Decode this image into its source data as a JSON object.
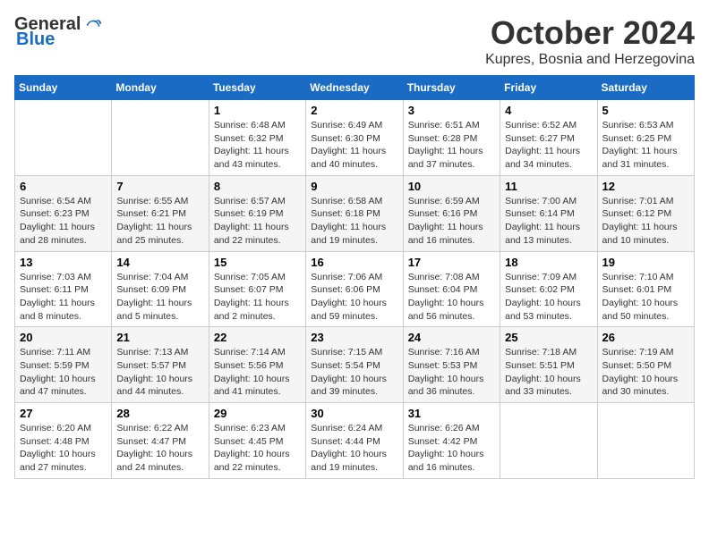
{
  "logo": {
    "general": "General",
    "blue": "Blue"
  },
  "title": "October 2024",
  "location": "Kupres, Bosnia and Herzegovina",
  "days_of_week": [
    "Sunday",
    "Monday",
    "Tuesday",
    "Wednesday",
    "Thursday",
    "Friday",
    "Saturday"
  ],
  "weeks": [
    [
      {
        "day": "",
        "info": ""
      },
      {
        "day": "",
        "info": ""
      },
      {
        "day": "1",
        "info": "Sunrise: 6:48 AM\nSunset: 6:32 PM\nDaylight: 11 hours and 43 minutes."
      },
      {
        "day": "2",
        "info": "Sunrise: 6:49 AM\nSunset: 6:30 PM\nDaylight: 11 hours and 40 minutes."
      },
      {
        "day": "3",
        "info": "Sunrise: 6:51 AM\nSunset: 6:28 PM\nDaylight: 11 hours and 37 minutes."
      },
      {
        "day": "4",
        "info": "Sunrise: 6:52 AM\nSunset: 6:27 PM\nDaylight: 11 hours and 34 minutes."
      },
      {
        "day": "5",
        "info": "Sunrise: 6:53 AM\nSunset: 6:25 PM\nDaylight: 11 hours and 31 minutes."
      }
    ],
    [
      {
        "day": "6",
        "info": "Sunrise: 6:54 AM\nSunset: 6:23 PM\nDaylight: 11 hours and 28 minutes."
      },
      {
        "day": "7",
        "info": "Sunrise: 6:55 AM\nSunset: 6:21 PM\nDaylight: 11 hours and 25 minutes."
      },
      {
        "day": "8",
        "info": "Sunrise: 6:57 AM\nSunset: 6:19 PM\nDaylight: 11 hours and 22 minutes."
      },
      {
        "day": "9",
        "info": "Sunrise: 6:58 AM\nSunset: 6:18 PM\nDaylight: 11 hours and 19 minutes."
      },
      {
        "day": "10",
        "info": "Sunrise: 6:59 AM\nSunset: 6:16 PM\nDaylight: 11 hours and 16 minutes."
      },
      {
        "day": "11",
        "info": "Sunrise: 7:00 AM\nSunset: 6:14 PM\nDaylight: 11 hours and 13 minutes."
      },
      {
        "day": "12",
        "info": "Sunrise: 7:01 AM\nSunset: 6:12 PM\nDaylight: 11 hours and 10 minutes."
      }
    ],
    [
      {
        "day": "13",
        "info": "Sunrise: 7:03 AM\nSunset: 6:11 PM\nDaylight: 11 hours and 8 minutes."
      },
      {
        "day": "14",
        "info": "Sunrise: 7:04 AM\nSunset: 6:09 PM\nDaylight: 11 hours and 5 minutes."
      },
      {
        "day": "15",
        "info": "Sunrise: 7:05 AM\nSunset: 6:07 PM\nDaylight: 11 hours and 2 minutes."
      },
      {
        "day": "16",
        "info": "Sunrise: 7:06 AM\nSunset: 6:06 PM\nDaylight: 10 hours and 59 minutes."
      },
      {
        "day": "17",
        "info": "Sunrise: 7:08 AM\nSunset: 6:04 PM\nDaylight: 10 hours and 56 minutes."
      },
      {
        "day": "18",
        "info": "Sunrise: 7:09 AM\nSunset: 6:02 PM\nDaylight: 10 hours and 53 minutes."
      },
      {
        "day": "19",
        "info": "Sunrise: 7:10 AM\nSunset: 6:01 PM\nDaylight: 10 hours and 50 minutes."
      }
    ],
    [
      {
        "day": "20",
        "info": "Sunrise: 7:11 AM\nSunset: 5:59 PM\nDaylight: 10 hours and 47 minutes."
      },
      {
        "day": "21",
        "info": "Sunrise: 7:13 AM\nSunset: 5:57 PM\nDaylight: 10 hours and 44 minutes."
      },
      {
        "day": "22",
        "info": "Sunrise: 7:14 AM\nSunset: 5:56 PM\nDaylight: 10 hours and 41 minutes."
      },
      {
        "day": "23",
        "info": "Sunrise: 7:15 AM\nSunset: 5:54 PM\nDaylight: 10 hours and 39 minutes."
      },
      {
        "day": "24",
        "info": "Sunrise: 7:16 AM\nSunset: 5:53 PM\nDaylight: 10 hours and 36 minutes."
      },
      {
        "day": "25",
        "info": "Sunrise: 7:18 AM\nSunset: 5:51 PM\nDaylight: 10 hours and 33 minutes."
      },
      {
        "day": "26",
        "info": "Sunrise: 7:19 AM\nSunset: 5:50 PM\nDaylight: 10 hours and 30 minutes."
      }
    ],
    [
      {
        "day": "27",
        "info": "Sunrise: 6:20 AM\nSunset: 4:48 PM\nDaylight: 10 hours and 27 minutes."
      },
      {
        "day": "28",
        "info": "Sunrise: 6:22 AM\nSunset: 4:47 PM\nDaylight: 10 hours and 24 minutes."
      },
      {
        "day": "29",
        "info": "Sunrise: 6:23 AM\nSunset: 4:45 PM\nDaylight: 10 hours and 22 minutes."
      },
      {
        "day": "30",
        "info": "Sunrise: 6:24 AM\nSunset: 4:44 PM\nDaylight: 10 hours and 19 minutes."
      },
      {
        "day": "31",
        "info": "Sunrise: 6:26 AM\nSunset: 4:42 PM\nDaylight: 10 hours and 16 minutes."
      },
      {
        "day": "",
        "info": ""
      },
      {
        "day": "",
        "info": ""
      }
    ]
  ]
}
